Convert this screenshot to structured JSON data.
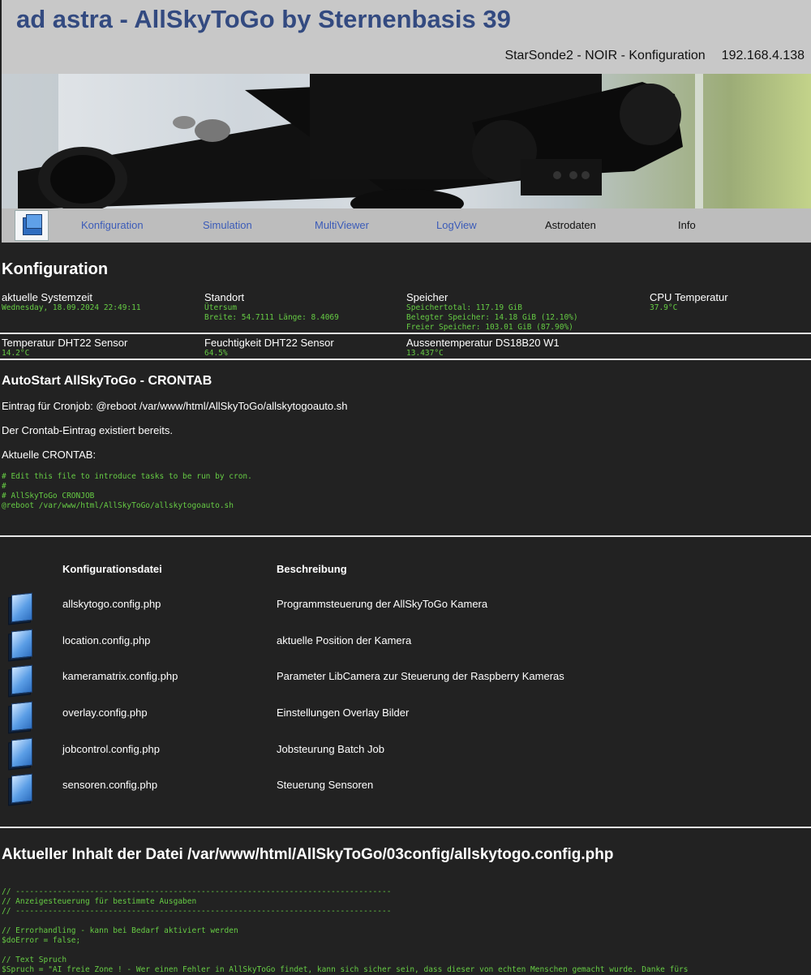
{
  "header": {
    "title": "ad astra - AllSkyToGo by Sternenbasis 39",
    "subtitle": "StarSonde2 - NOIR - Konfiguration",
    "ip": "192.168.4.138"
  },
  "nav": {
    "items": [
      {
        "label": "Konfiguration"
      },
      {
        "label": "Simulation"
      },
      {
        "label": "MultiViewer"
      },
      {
        "label": "LogView"
      },
      {
        "label": "Astrodaten"
      },
      {
        "label": "Info"
      }
    ]
  },
  "config": {
    "heading": "Konfiguration",
    "system_time": {
      "label": "aktuelle Systemzeit",
      "value": "Wednesday, 18.09.2024 22:49:11"
    },
    "location": {
      "label": "Standort",
      "value": "Ütersum",
      "value2": "Breite: 54.7111 Länge: 8.4069"
    },
    "storage": {
      "label": "Speicher",
      "total": "Speichertotal: 117.19 GiB",
      "used": "Belegter Speicher: 14.18 GiB (12.10%)",
      "free": "Freier Speicher: 103.01 GiB (87.90%)"
    },
    "cpu_temp": {
      "label": "CPU Temperatur",
      "value": "37.9°C"
    },
    "dht_temp": {
      "label": "Temperatur DHT22 Sensor",
      "value": "14.2°C"
    },
    "dht_humidity": {
      "label": "Feuchtigkeit DHT22 Sensor",
      "value": "64.5%"
    },
    "outside_temp": {
      "label": "Aussentemperatur DS18B20 W1",
      "value": "13.437°C"
    }
  },
  "autostart": {
    "heading": "AutoStart AllSkyToGo - CRONTAB",
    "entry": "Eintrag für Cronjob: @reboot /var/www/html/AllSkyToGo/allskytogoauto.sh",
    "exists": "Der Crontab-Eintrag existiert bereits.",
    "current": "Aktuelle CRONTAB:",
    "crontab_lines": [
      "# Edit this file to introduce tasks to be run by cron.",
      "#",
      "# AllSkyToGo CRONJOB",
      "@reboot /var/www/html/AllSkyToGo/allskytogoauto.sh"
    ]
  },
  "files": {
    "col_file": "Konfigurationsdatei",
    "col_desc": "Beschreibung",
    "rows": [
      {
        "file": "allskytogo.config.php",
        "desc": "Programmsteuerung der AllSkyToGo Kamera"
      },
      {
        "file": "location.config.php",
        "desc": "aktuelle Position der Kamera"
      },
      {
        "file": "kameramatrix.config.php",
        "desc": "Parameter LibCamera zur Steuerung der Raspberry Kameras"
      },
      {
        "file": "overlay.config.php",
        "desc": "Einstellungen Overlay Bilder"
      },
      {
        "file": "jobcontrol.config.php",
        "desc": "Jobsteurung Batch Job"
      },
      {
        "file": "sensoren.config.php",
        "desc": "Steuerung Sensoren"
      }
    ]
  },
  "content": {
    "heading": "Aktueller Inhalt der Datei /var/www/html/AllSkyToGo/03config/allskytogo.config.php",
    "lines": [
      "// ---------------------------------------------------------------------------------",
      "// Anzeigesteuerung für bestimmte Ausgaben",
      "// ---------------------------------------------------------------------------------",
      "",
      "// Errorhandling - kann bei Bedarf aktiviert werden",
      "$doError = false;",
      "",
      "// Text Spruch",
      "$Spruch = \"AI freie Zone ! - Wer einen Fehler in AllSkyToGo findet, kann sich sicher sein, dass dieser von echten Menschen gemacht wurde. Danke fürs"
    ]
  },
  "colors": {
    "background": "#222222",
    "header_bg": "#c8c8c8",
    "title": "#334a80",
    "nav_bg": "#bdbdbd",
    "nav_link": "#3b5bb8",
    "mono_green": "#66cc44"
  }
}
